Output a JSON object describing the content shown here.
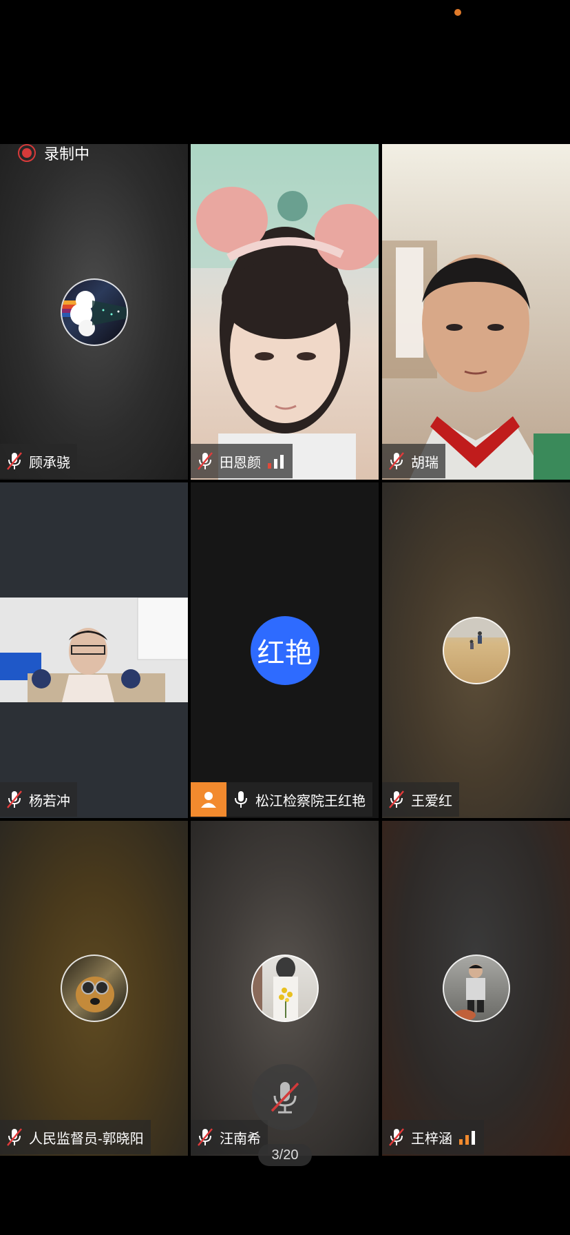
{
  "recording": {
    "label": "录制中"
  },
  "participants": [
    {
      "name": "顾承骁",
      "mic": "muted",
      "avatar": "rainbow-galaxy-avatar"
    },
    {
      "name": "田恩颜",
      "mic": "muted",
      "video": "girl-with-bunny-ears",
      "signal": "low"
    },
    {
      "name": "胡瑞",
      "mic": "muted",
      "video": "boy-red-scarf"
    },
    {
      "name": "杨若冲",
      "mic": "muted",
      "video": "boy-in-room"
    },
    {
      "name": "松江检察院王红艳",
      "mic": "on",
      "initials": "红艳",
      "role_icon": "person-icon"
    },
    {
      "name": "王爱红",
      "mic": "muted",
      "avatar": "beach-walk-avatar"
    },
    {
      "name": "人民监督员-郭晓阳",
      "mic": "muted",
      "avatar": "dog-goggles-avatar"
    },
    {
      "name": "汪南希",
      "mic": "muted",
      "avatar": "flowers-girl-avatar"
    },
    {
      "name": "王梓涵",
      "mic": "muted",
      "avatar": "kid-jacket-avatar",
      "signal": "medium"
    }
  ],
  "page_indicator": "3/20",
  "colors": {
    "accent_orange": "#f28a2e",
    "initials_blue": "#2e6bff",
    "rec_red": "#d73a3a"
  }
}
